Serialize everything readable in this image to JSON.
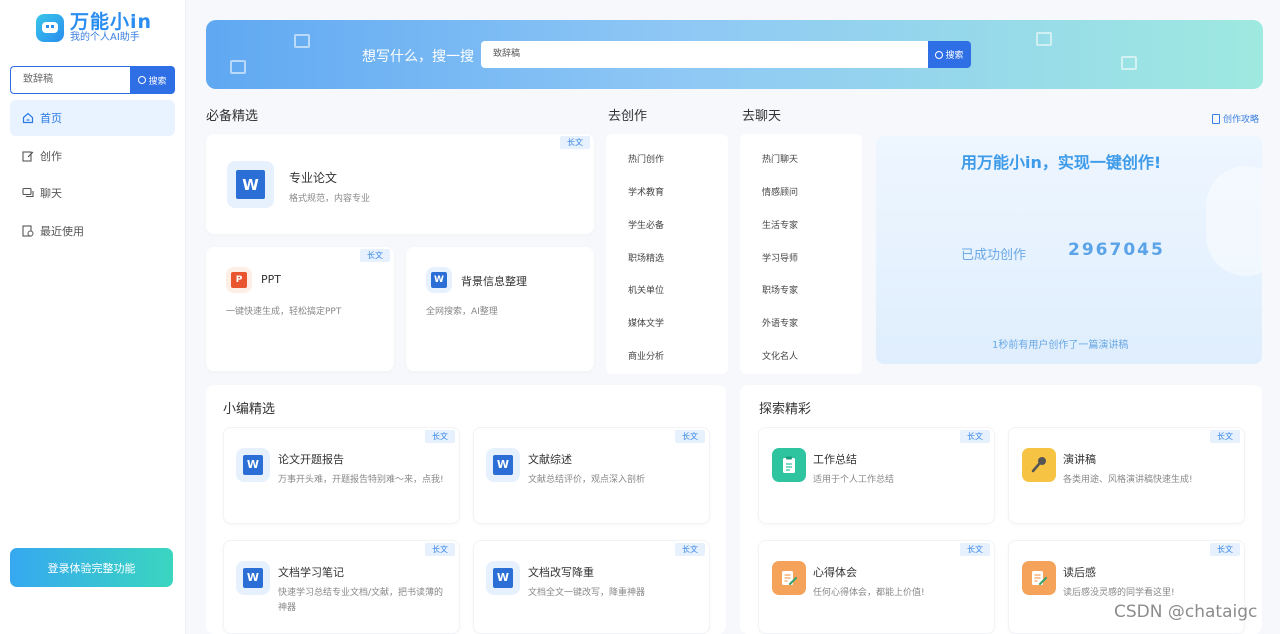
{
  "app": {
    "title": "万能小in",
    "subtitle": "我的个人AI助手"
  },
  "sidebar": {
    "search": {
      "placeholder": "致辞稿",
      "button": "搜索"
    },
    "items": [
      {
        "label": "首页",
        "icon": "home-icon",
        "active": true
      },
      {
        "label": "创作",
        "icon": "edit-icon"
      },
      {
        "label": "聊天",
        "icon": "chat-icon"
      },
      {
        "label": "最近使用",
        "icon": "history-icon"
      }
    ],
    "login_button": "登录体验完整功能"
  },
  "banner": {
    "label": "想写什么，搜一搜",
    "search_value": "致辞稿",
    "button": "搜索"
  },
  "essentials": {
    "title": "必备精选",
    "cards": [
      {
        "title": "专业论文",
        "desc": "格式规范，内容专业",
        "tag": "长文",
        "icon": "word-icon"
      },
      {
        "title": "PPT",
        "desc": "一键快速生成，轻松搞定PPT",
        "tag": "长文",
        "icon": "ppt-icon"
      },
      {
        "title": "背景信息整理",
        "desc": "全网搜索，AI整理",
        "tag": "",
        "icon": "word-icon"
      }
    ]
  },
  "create": {
    "title": "去创作",
    "items": [
      "热门创作",
      "学术教育",
      "学生必备",
      "职场精选",
      "机关单位",
      "媒体文学",
      "商业分析"
    ]
  },
  "chat": {
    "title": "去聊天",
    "items": [
      "热门聊天",
      "情感顾问",
      "生活专家",
      "学习导师",
      "职场专家",
      "外语专家",
      "文化名人"
    ]
  },
  "strategy_link": "创作攻略",
  "promo": {
    "title": "用万能小in，实现一键创作!",
    "count_label": "已成功创作",
    "count": "2967045",
    "footer": "1秒前有用户创作了一篇演讲稿"
  },
  "editor_picks": {
    "title": "小编精选",
    "cards": [
      {
        "title": "论文开题报告",
        "desc": "万事开头难，开题报告特别难～来，点我!",
        "tag": "长文"
      },
      {
        "title": "文献综述",
        "desc": "文献总结评价，观点深入剖析",
        "tag": "长文"
      },
      {
        "title": "文档学习笔记",
        "desc": "快速学习总结专业文档/文献，把书读薄的神器",
        "tag": "长文"
      },
      {
        "title": "文档改写降重",
        "desc": "文档全文一键改写，降重神器",
        "tag": "长文"
      }
    ]
  },
  "explore": {
    "title": "探索精彩",
    "cards": [
      {
        "title": "工作总结",
        "desc": "适用于个人工作总结",
        "tag": "长文",
        "icon": "clipboard-icon",
        "color": "#2ec4a0"
      },
      {
        "title": "演讲稿",
        "desc": "各类用途、风格演讲稿快速生成!",
        "tag": "长文",
        "icon": "microphone-icon",
        "color": "#f6c343"
      },
      {
        "title": "心得体会",
        "desc": "任何心得体会，都能上价值!",
        "tag": "长文",
        "icon": "notes-icon",
        "color": "#f5a25a"
      },
      {
        "title": "读后感",
        "desc": "读后感没灵感的同学看这里!",
        "tag": "长文",
        "icon": "notes-icon",
        "color": "#f5a25a"
      }
    ]
  },
  "watermark": "CSDN @chataigc"
}
